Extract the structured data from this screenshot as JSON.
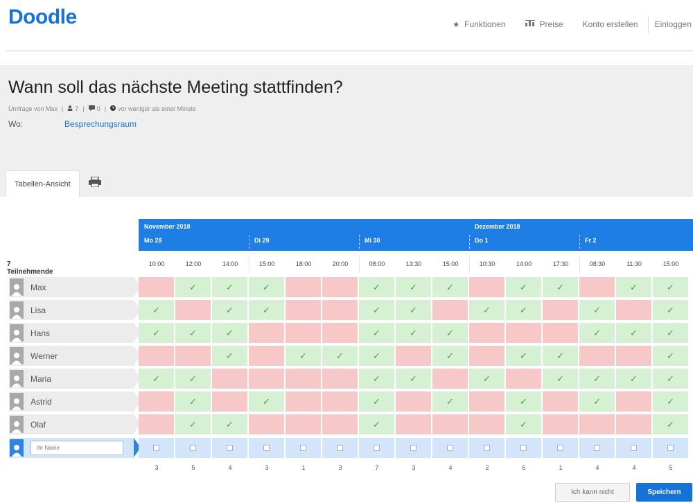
{
  "app": {
    "logo": "Doodle"
  },
  "nav": {
    "features": "Funktionen",
    "pricing": "Preise",
    "signup": "Konto erstellen",
    "login": "Einloggen"
  },
  "poll": {
    "title": "Wann soll das nächste Meeting stattfinden?",
    "author": "Umfrage von Max",
    "participants_count": "7",
    "comments_count": "0",
    "time_ago": "vor weniger als einer Minute",
    "where_label": "Wo:",
    "location": "Besprechungsraum"
  },
  "tabs": {
    "table_view": "Tabellen-Ansicht"
  },
  "months": [
    "November 2018",
    "Dezember 2018"
  ],
  "days": [
    "Mo 28",
    "Di 29",
    "Mi 30",
    "Do 1",
    "Fr 2"
  ],
  "participants_label": "7 Teilnehmende",
  "times": [
    "10:00",
    "12:00",
    "14:00",
    "15:00",
    "18:00",
    "20:00",
    "08:00",
    "13:30",
    "15:00",
    "10:30",
    "14:00",
    "17:30",
    "08:30",
    "11:30",
    "15:00"
  ],
  "participants": [
    {
      "name": "Max",
      "votes": "011100111011011"
    },
    {
      "name": "Lisa",
      "votes": "101100110110101"
    },
    {
      "name": "Hans",
      "votes": "111000111000111"
    },
    {
      "name": "Werner",
      "votes": "001011101011001"
    },
    {
      "name": "Maria",
      "votes": "110000110101111"
    },
    {
      "name": "Astrid",
      "votes": "010100101010101"
    },
    {
      "name": "Olaf",
      "votes": "011000100010001"
    }
  ],
  "vote_icons": {
    "yes": "✓",
    "no": ""
  },
  "name_placeholder": "Ihr Name",
  "totals": [
    "3",
    "5",
    "4",
    "3",
    "1",
    "3",
    "7",
    "3",
    "4",
    "2",
    "6",
    "1",
    "4",
    "4",
    "5"
  ],
  "buttons": {
    "cant": "Ich kann nicht",
    "save": "Speichern"
  },
  "colors": {
    "brand": "#1573d8",
    "header_blue": "#1e7ee6",
    "yes_bg": "#d5f0d2",
    "no_bg": "#f6c8c8",
    "input_row_bg": "#d3e5fa"
  },
  "icons": {
    "features": "star-icon",
    "pricing": "pricing-icon",
    "participants": "person-icon",
    "comments": "comment-icon",
    "time": "clock-icon",
    "print": "printer-icon",
    "avatar": "user-avatar-icon"
  }
}
